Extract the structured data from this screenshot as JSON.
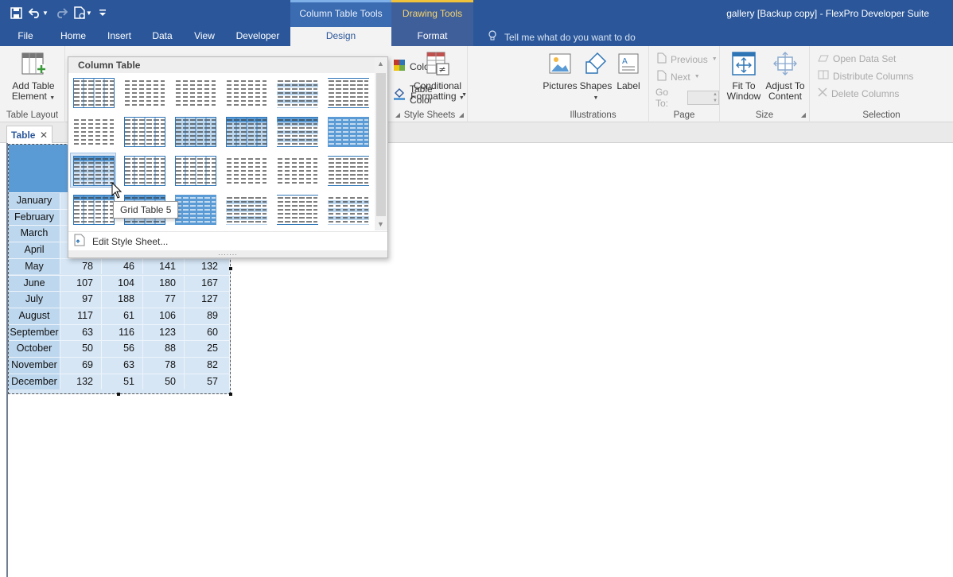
{
  "window": {
    "title": "gallery [Backup copy] - FlexPro Developer Suite"
  },
  "quick_access": {
    "icons": [
      "save-icon",
      "undo-icon",
      "redo-icon",
      "new-document-icon",
      "customize-icon"
    ]
  },
  "contextual_groups": {
    "column_table_tools": "Column Table Tools",
    "drawing_tools": "Drawing Tools"
  },
  "tabs": [
    {
      "label": "File"
    },
    {
      "label": "Home"
    },
    {
      "label": "Insert"
    },
    {
      "label": "Data"
    },
    {
      "label": "View"
    },
    {
      "label": "Developer"
    },
    {
      "label": "Design"
    },
    {
      "label": "Format"
    }
  ],
  "tellme": {
    "placeholder": "Tell me what do you want to do"
  },
  "ribbon": {
    "table_layout": {
      "button": "Add Table",
      "button_line2": "Element",
      "group": "Table Layout"
    },
    "style_sheets": {
      "colors": "Colors",
      "table_color": "Table Color",
      "group": "Style Sheets"
    },
    "conditional": {
      "line1": "Conditional",
      "line2": "Formatting"
    },
    "illustrations": {
      "pictures": "Pictures",
      "shapes": "Shapes",
      "label": "Label",
      "group": "Illustrations"
    },
    "page": {
      "previous": "Previous",
      "next": "Next",
      "goto": "Go To:",
      "group": "Page"
    },
    "size": {
      "fit1": "Fit To",
      "fit2": "Window",
      "adjust1": "Adjust To",
      "adjust2": "Content",
      "group": "Size"
    },
    "selection": {
      "open_data_set": "Open Data Set",
      "distribute_columns": "Distribute Columns",
      "delete_columns": "Delete Columns",
      "group": "Selection"
    }
  },
  "document": {
    "tab_label": "Table",
    "close": "✕"
  },
  "gallery": {
    "title": "Column Table",
    "edit_style_sheet": "Edit Style Sheet...",
    "tooltip": "Grid Table 5",
    "grip": "......."
  },
  "table": {
    "rows": [
      {
        "month": "January",
        "values": [
          "",
          "",
          "",
          ""
        ]
      },
      {
        "month": "February",
        "values": [
          "",
          "",
          "",
          ""
        ]
      },
      {
        "month": "March",
        "values": [
          "",
          "",
          "",
          ""
        ]
      },
      {
        "month": "April",
        "values": [
          "",
          "",
          "",
          ""
        ]
      },
      {
        "month": "May",
        "values": [
          "78",
          "46",
          "141",
          "132"
        ]
      },
      {
        "month": "June",
        "values": [
          "107",
          "104",
          "180",
          "167"
        ]
      },
      {
        "month": "July",
        "values": [
          "97",
          "188",
          "77",
          "127"
        ]
      },
      {
        "month": "August",
        "values": [
          "117",
          "61",
          "106",
          "89"
        ]
      },
      {
        "month": "September",
        "values": [
          "63",
          "116",
          "123",
          "60"
        ]
      },
      {
        "month": "October",
        "values": [
          "50",
          "56",
          "88",
          "25"
        ]
      },
      {
        "month": "November",
        "values": [
          "69",
          "63",
          "78",
          "82"
        ]
      },
      {
        "month": "December",
        "values": [
          "132",
          "51",
          "50",
          "57"
        ]
      }
    ]
  },
  "colors": {
    "titlebar": "#2b579a",
    "accent_blue": "#5b9bd5",
    "light_blue": "#bdd7ee",
    "drawing_tools": "#f6d46b"
  }
}
